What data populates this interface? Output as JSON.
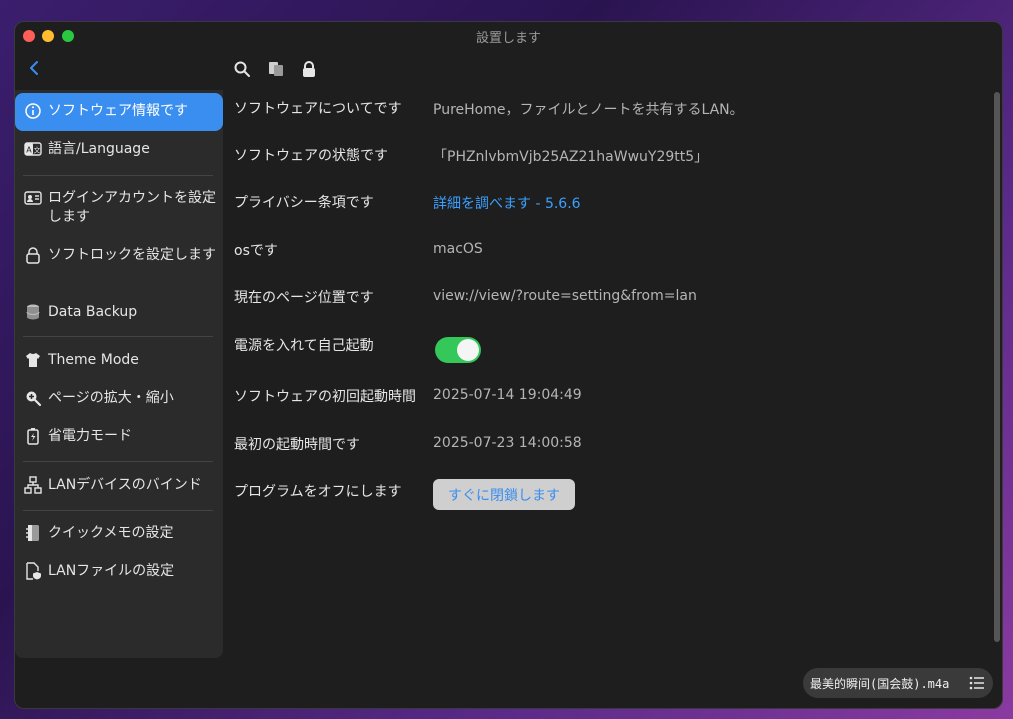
{
  "window": {
    "title": "設置します"
  },
  "sidebar": {
    "items": [
      {
        "label": "ソフトウェア情報です",
        "icon": "info-icon"
      },
      {
        "label": "語言/Language",
        "icon": "translate-icon"
      },
      {
        "label": "ログインアカウントを設定します",
        "icon": "id-card-icon"
      },
      {
        "label": "ソフトロックを設定します",
        "icon": "lock-icon"
      },
      {
        "label": "Data Backup",
        "icon": "database-icon"
      },
      {
        "label": "Theme Mode",
        "icon": "tshirt-icon"
      },
      {
        "label": "ページの拡大・縮小",
        "icon": "zoom-icon"
      },
      {
        "label": "省電力モード",
        "icon": "battery-icon"
      },
      {
        "label": "LANデバイスのバインド",
        "icon": "network-icon"
      },
      {
        "label": "クイックメモの設定",
        "icon": "notebook-icon"
      },
      {
        "label": "LANファイルの設定",
        "icon": "file-shield-icon"
      }
    ]
  },
  "rows": [
    {
      "label": "ソフトウェアについてです",
      "value": "PureHome，ファイルとノートを共有するLAN。"
    },
    {
      "label": "ソフトウェアの状態です",
      "value": "「PHZnlvbmVjb25AZ21haWwuY29tt5」"
    },
    {
      "label": "プライバシー条項です",
      "value": "詳細を調べます - 5.6.6"
    },
    {
      "label": "osです",
      "value": "macOS"
    },
    {
      "label": "現在のページ位置です",
      "value": "view://view/?route=setting&from=lan"
    },
    {
      "label": "電源を入れて自己起動",
      "value": ""
    },
    {
      "label": "ソフトウェアの初回起動時間",
      "value": "2025-07-14 19:04:49"
    },
    {
      "label": "最初の起動時間です",
      "value": "2025-07-23 14:00:58"
    },
    {
      "label": "プログラムをオフにします",
      "value": ""
    }
  ],
  "autostart": {
    "enabled": true
  },
  "close_button": {
    "label": "すぐに閉鎖します"
  },
  "player": {
    "track": "最美的瞬间(国会鼓).m4a"
  },
  "colors": {
    "accent": "#3a8ef0",
    "toggle_on": "#34c759",
    "link": "#3aa0ff"
  }
}
